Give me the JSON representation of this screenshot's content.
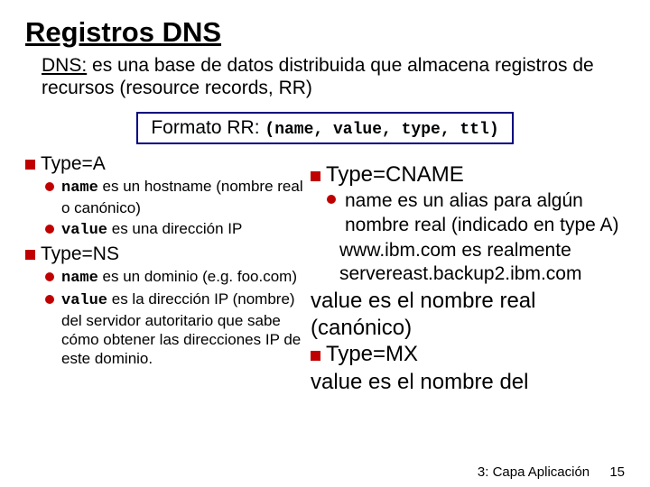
{
  "title": "Registros DNS",
  "subtitle_lead": "DNS:",
  "subtitle_rest": " es una base de datos distribuida que almacena registros de recursos (resource records, RR)",
  "rrformat_label": "Formato RR: ",
  "rrformat_tuple": "(name, value, type, ttl)",
  "left": {
    "typeA": "Type=A",
    "a1_pre": "name",
    "a1_post": " es un hostname (nombre real o canónico)",
    "a2_pre": "value",
    "a2_post": " es una dirección IP",
    "typeNS": "Type=NS",
    "ns1_pre": "name",
    "ns1_post": " es un dominio (e.g. foo.com)",
    "ns2_pre": "value",
    "ns2_post": " es la dirección IP (nombre) del servidor autoritario que sabe cómo obtener las direcciones IP de este dominio."
  },
  "right": {
    "typeCNAME": "Type=CNAME",
    "c1": "name es un alias para algún nombre real (indicado en type A)",
    "c2": "www.ibm.com es realmente servereast.backup2.ibm.com",
    "c3": "value es el nombre real (canónico)",
    "typeMX": "Type=MX",
    "mx1": "value es el nombre del"
  },
  "footer_label": "3: Capa Aplicación",
  "footer_page": "15"
}
